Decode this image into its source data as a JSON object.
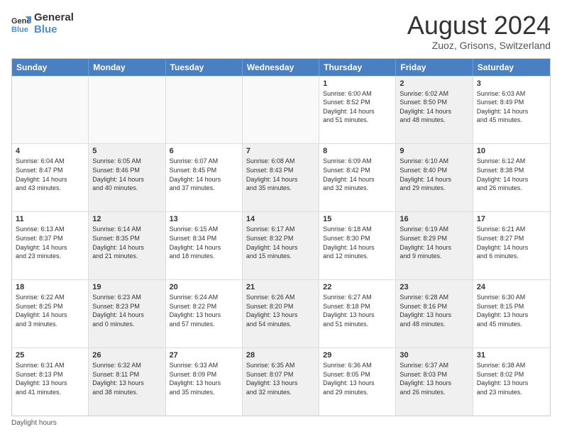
{
  "logo": {
    "line1": "General",
    "line2": "Blue"
  },
  "title": "August 2024",
  "location": "Zuoz, Grisons, Switzerland",
  "header_days": [
    "Sunday",
    "Monday",
    "Tuesday",
    "Wednesday",
    "Thursday",
    "Friday",
    "Saturday"
  ],
  "footer": "Daylight hours",
  "weeks": [
    [
      {
        "day": "",
        "info": "",
        "shaded": false,
        "empty": true
      },
      {
        "day": "",
        "info": "",
        "shaded": false,
        "empty": true
      },
      {
        "day": "",
        "info": "",
        "shaded": false,
        "empty": true
      },
      {
        "day": "",
        "info": "",
        "shaded": false,
        "empty": true
      },
      {
        "day": "1",
        "info": "Sunrise: 6:00 AM\nSunset: 8:52 PM\nDaylight: 14 hours\nand 51 minutes.",
        "shaded": false,
        "empty": false
      },
      {
        "day": "2",
        "info": "Sunrise: 6:02 AM\nSunset: 8:50 PM\nDaylight: 14 hours\nand 48 minutes.",
        "shaded": true,
        "empty": false
      },
      {
        "day": "3",
        "info": "Sunrise: 6:03 AM\nSunset: 8:49 PM\nDaylight: 14 hours\nand 45 minutes.",
        "shaded": false,
        "empty": false
      }
    ],
    [
      {
        "day": "4",
        "info": "Sunrise: 6:04 AM\nSunset: 8:47 PM\nDaylight: 14 hours\nand 43 minutes.",
        "shaded": false,
        "empty": false
      },
      {
        "day": "5",
        "info": "Sunrise: 6:05 AM\nSunset: 8:46 PM\nDaylight: 14 hours\nand 40 minutes.",
        "shaded": true,
        "empty": false
      },
      {
        "day": "6",
        "info": "Sunrise: 6:07 AM\nSunset: 8:45 PM\nDaylight: 14 hours\nand 37 minutes.",
        "shaded": false,
        "empty": false
      },
      {
        "day": "7",
        "info": "Sunrise: 6:08 AM\nSunset: 8:43 PM\nDaylight: 14 hours\nand 35 minutes.",
        "shaded": true,
        "empty": false
      },
      {
        "day": "8",
        "info": "Sunrise: 6:09 AM\nSunset: 8:42 PM\nDaylight: 14 hours\nand 32 minutes.",
        "shaded": false,
        "empty": false
      },
      {
        "day": "9",
        "info": "Sunrise: 6:10 AM\nSunset: 8:40 PM\nDaylight: 14 hours\nand 29 minutes.",
        "shaded": true,
        "empty": false
      },
      {
        "day": "10",
        "info": "Sunrise: 6:12 AM\nSunset: 8:38 PM\nDaylight: 14 hours\nand 26 minutes.",
        "shaded": false,
        "empty": false
      }
    ],
    [
      {
        "day": "11",
        "info": "Sunrise: 6:13 AM\nSunset: 8:37 PM\nDaylight: 14 hours\nand 23 minutes.",
        "shaded": false,
        "empty": false
      },
      {
        "day": "12",
        "info": "Sunrise: 6:14 AM\nSunset: 8:35 PM\nDaylight: 14 hours\nand 21 minutes.",
        "shaded": true,
        "empty": false
      },
      {
        "day": "13",
        "info": "Sunrise: 6:15 AM\nSunset: 8:34 PM\nDaylight: 14 hours\nand 18 minutes.",
        "shaded": false,
        "empty": false
      },
      {
        "day": "14",
        "info": "Sunrise: 6:17 AM\nSunset: 8:32 PM\nDaylight: 14 hours\nand 15 minutes.",
        "shaded": true,
        "empty": false
      },
      {
        "day": "15",
        "info": "Sunrise: 6:18 AM\nSunset: 8:30 PM\nDaylight: 14 hours\nand 12 minutes.",
        "shaded": false,
        "empty": false
      },
      {
        "day": "16",
        "info": "Sunrise: 6:19 AM\nSunset: 8:29 PM\nDaylight: 14 hours\nand 9 minutes.",
        "shaded": true,
        "empty": false
      },
      {
        "day": "17",
        "info": "Sunrise: 6:21 AM\nSunset: 8:27 PM\nDaylight: 14 hours\nand 6 minutes.",
        "shaded": false,
        "empty": false
      }
    ],
    [
      {
        "day": "18",
        "info": "Sunrise: 6:22 AM\nSunset: 8:25 PM\nDaylight: 14 hours\nand 3 minutes.",
        "shaded": false,
        "empty": false
      },
      {
        "day": "19",
        "info": "Sunrise: 6:23 AM\nSunset: 8:23 PM\nDaylight: 14 hours\nand 0 minutes.",
        "shaded": true,
        "empty": false
      },
      {
        "day": "20",
        "info": "Sunrise: 6:24 AM\nSunset: 8:22 PM\nDaylight: 13 hours\nand 57 minutes.",
        "shaded": false,
        "empty": false
      },
      {
        "day": "21",
        "info": "Sunrise: 6:26 AM\nSunset: 8:20 PM\nDaylight: 13 hours\nand 54 minutes.",
        "shaded": true,
        "empty": false
      },
      {
        "day": "22",
        "info": "Sunrise: 6:27 AM\nSunset: 8:18 PM\nDaylight: 13 hours\nand 51 minutes.",
        "shaded": false,
        "empty": false
      },
      {
        "day": "23",
        "info": "Sunrise: 6:28 AM\nSunset: 8:16 PM\nDaylight: 13 hours\nand 48 minutes.",
        "shaded": true,
        "empty": false
      },
      {
        "day": "24",
        "info": "Sunrise: 6:30 AM\nSunset: 8:15 PM\nDaylight: 13 hours\nand 45 minutes.",
        "shaded": false,
        "empty": false
      }
    ],
    [
      {
        "day": "25",
        "info": "Sunrise: 6:31 AM\nSunset: 8:13 PM\nDaylight: 13 hours\nand 41 minutes.",
        "shaded": false,
        "empty": false
      },
      {
        "day": "26",
        "info": "Sunrise: 6:32 AM\nSunset: 8:11 PM\nDaylight: 13 hours\nand 38 minutes.",
        "shaded": true,
        "empty": false
      },
      {
        "day": "27",
        "info": "Sunrise: 6:33 AM\nSunset: 8:09 PM\nDaylight: 13 hours\nand 35 minutes.",
        "shaded": false,
        "empty": false
      },
      {
        "day": "28",
        "info": "Sunrise: 6:35 AM\nSunset: 8:07 PM\nDaylight: 13 hours\nand 32 minutes.",
        "shaded": true,
        "empty": false
      },
      {
        "day": "29",
        "info": "Sunrise: 6:36 AM\nSunset: 8:05 PM\nDaylight: 13 hours\nand 29 minutes.",
        "shaded": false,
        "empty": false
      },
      {
        "day": "30",
        "info": "Sunrise: 6:37 AM\nSunset: 8:03 PM\nDaylight: 13 hours\nand 26 minutes.",
        "shaded": true,
        "empty": false
      },
      {
        "day": "31",
        "info": "Sunrise: 6:38 AM\nSunset: 8:02 PM\nDaylight: 13 hours\nand 23 minutes.",
        "shaded": false,
        "empty": false
      }
    ]
  ]
}
